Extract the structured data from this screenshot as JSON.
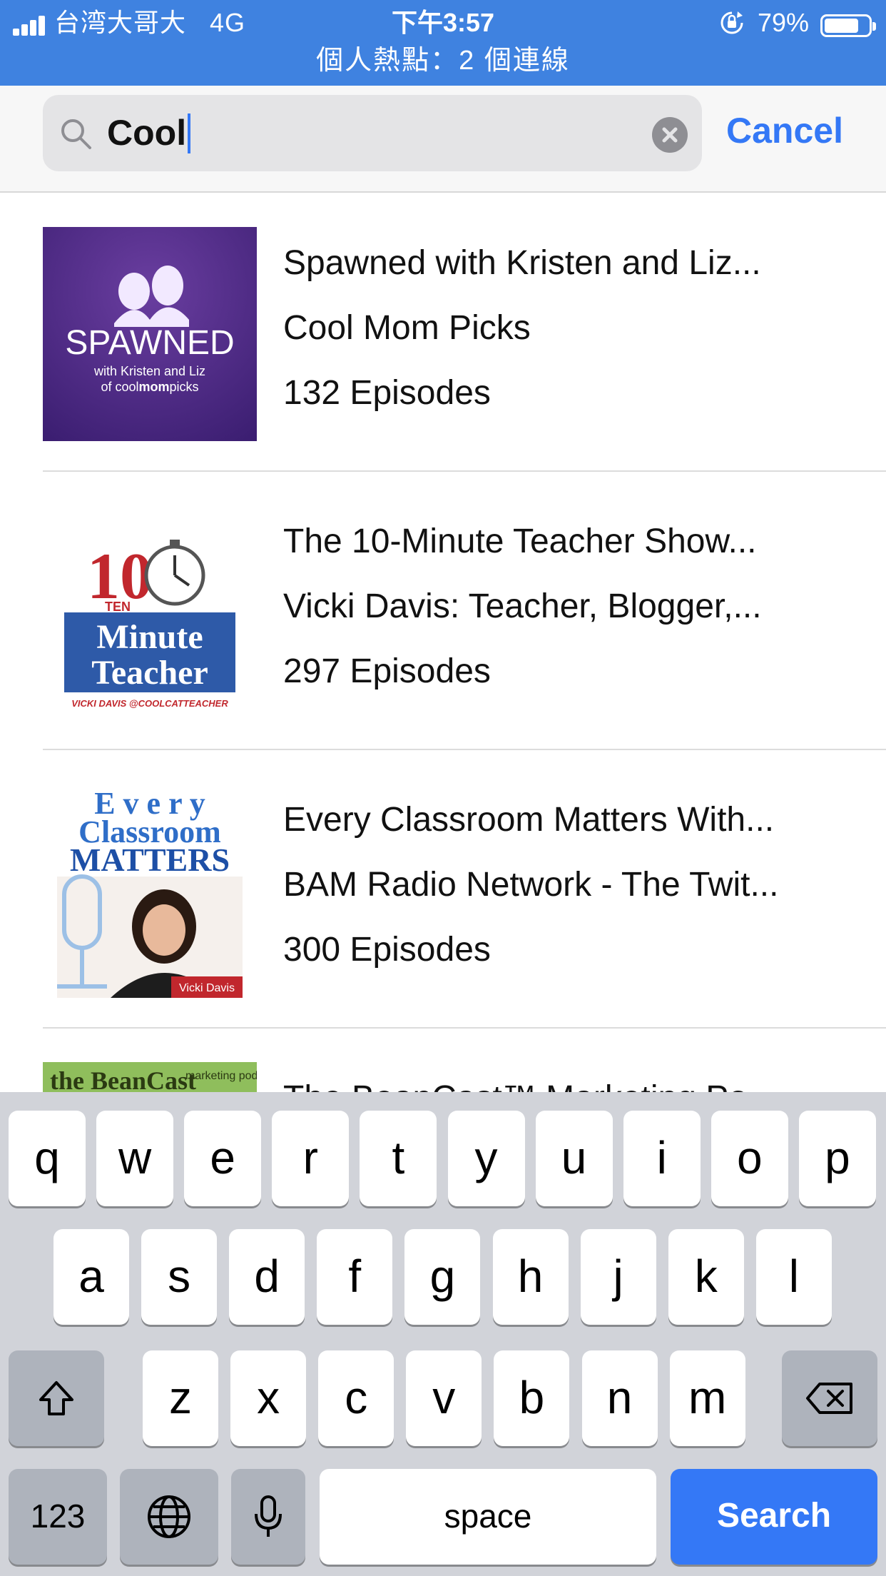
{
  "status_bar": {
    "carrier": "台湾大哥大",
    "network": "4G",
    "time": "下午3:57",
    "battery_percent": "79%",
    "battery_level": 0.79,
    "hotspot": "個人熱點：2 個連線",
    "background_color": "#3f82e0"
  },
  "search": {
    "query": "Cool",
    "cancel_label": "Cancel",
    "accent_color": "#3478f6"
  },
  "results": [
    {
      "title": "Spawned with Kristen and Liz...",
      "author": "Cool Mom Picks",
      "episodes": "132 Episodes",
      "art": {
        "name": "SPAWNED",
        "sub1": "with Kristen and Liz",
        "sub2a": "of cool",
        "sub2b": "mom",
        "sub2c": "picks"
      }
    },
    {
      "title": "The 10-Minute Teacher Show...",
      "author": "Vicki Davis: Teacher, Blogger,...",
      "episodes": "297 Episodes",
      "art": {
        "num": "10",
        "ten": "TEN",
        "line1": "Minute",
        "line2": "Teacher",
        "byline": "VICKI DAVIS @COOLCATTEACHER"
      }
    },
    {
      "title": "Every Classroom Matters With...",
      "author": "BAM Radio Network - The Twit...",
      "episodes": "300 Episodes",
      "art": {
        "line1": "E v e r y",
        "line2": "Classroom",
        "line3": "MATTERS",
        "tag": "Vicki Davis"
      }
    },
    {
      "title": "The BeanCast™ Marketing Po...",
      "author": "",
      "episodes": "",
      "art": {
        "name": "the BeanCast",
        "tag": "marketing podcast"
      }
    }
  ],
  "keyboard": {
    "row1": [
      "q",
      "w",
      "e",
      "r",
      "t",
      "y",
      "u",
      "i",
      "o",
      "p"
    ],
    "row2": [
      "a",
      "s",
      "d",
      "f",
      "g",
      "h",
      "j",
      "k",
      "l"
    ],
    "row3": [
      "z",
      "x",
      "c",
      "v",
      "b",
      "n",
      "m"
    ],
    "numbers_label": "123",
    "space_label": "space",
    "search_label": "Search",
    "icons": [
      "shift-icon",
      "backspace-icon",
      "globe-icon",
      "microphone-icon"
    ]
  }
}
